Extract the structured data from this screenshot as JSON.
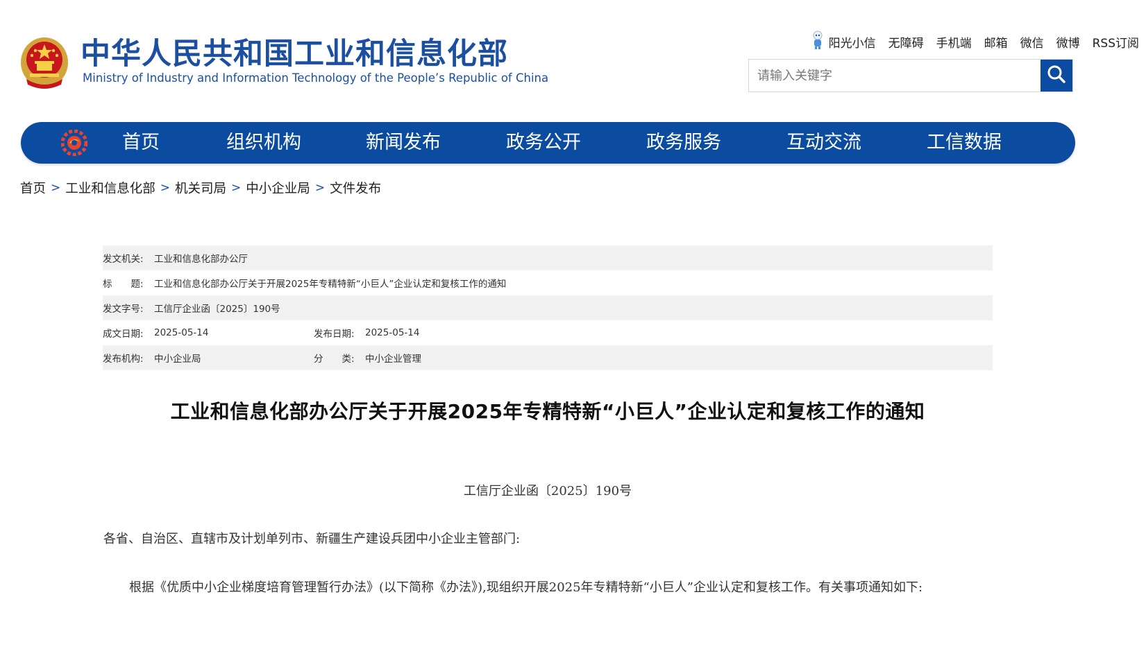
{
  "header": {
    "title": "中华人民共和国工业和信息化部",
    "subtitle": "Ministry of Industry and Information Technology of the People’s Republic of China",
    "emblem_icon": "national-emblem-icon",
    "top_links": [
      "阳光小信",
      "无障碍",
      "手机端",
      "邮箱",
      "微信",
      "微博",
      "RSS订阅"
    ],
    "search_placeholder": "请输入关键字",
    "accent_color": "#0b4ba0"
  },
  "nav": {
    "items": [
      "首页",
      "组织机构",
      "新闻发布",
      "政务公开",
      "政务服务",
      "互动交流",
      "工信数据"
    ]
  },
  "breadcrumb": [
    "首页",
    "工业和信息化部",
    "机关司局",
    "中小企业局",
    "文件发布"
  ],
  "meta": {
    "issuer_label": "发文机关:",
    "issuer": "工业和信息化部办公厅",
    "title_label": "标　　题:",
    "title": "工业和信息化部办公厅关于开展2025年专精特新“小巨人”企业认定和复核工作的通知",
    "docno_label": "发文字号:",
    "docno": "工信厅企业函〔2025〕190号",
    "written_label": "成文日期:",
    "written": "2025-05-14",
    "published_label": "发布日期:",
    "published": "2025-05-14",
    "org_label": "发布机构:",
    "org": "中小企业局",
    "category_label": "分　　类:",
    "category": "中小企业管理"
  },
  "article": {
    "title": "工业和信息化部办公厅关于开展2025年专精特新“小巨人”企业认定和复核工作的通知",
    "doc_number": "工信厅企业函〔2025〕190号",
    "recipient": "各省、自治区、直辖市及计划单列市、新疆生产建设兵团中小企业主管部门:",
    "paragraph1": "根据《优质中小企业梯度培育管理暂行办法》(以下简称《办法》),现组织开展2025年专精特新“小巨人”企业认定和复核工作。有关事项通知如下:"
  }
}
